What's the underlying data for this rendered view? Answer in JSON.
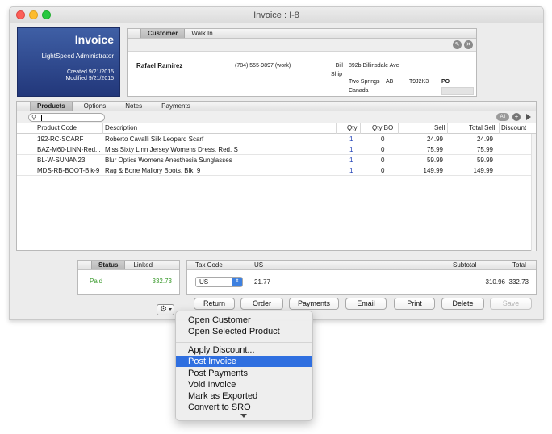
{
  "window": {
    "title": "Invoice : I-8"
  },
  "badge": {
    "title": "Invoice",
    "user": "LightSpeed Administrator",
    "created": "Created 9/21/2015",
    "modified": "Modified 9/21/2015"
  },
  "customer": {
    "tabs": [
      "Customer",
      "Walk In"
    ],
    "name": "Rafael Ramirez",
    "phone": "(784) 555-9897 (work)",
    "bill_label": "Bill",
    "ship_label": "Ship",
    "address": "892b Billinsdale Ave",
    "city": "Two Springs",
    "state": "AB",
    "zip": "T9J2K3",
    "country": "Canada",
    "po_label": "PO",
    "icons": [
      "edit-icon",
      "close-icon"
    ]
  },
  "products": {
    "tabs": [
      "Products",
      "Options",
      "Notes",
      "Payments"
    ],
    "search_placeholder": "",
    "all_label": "All",
    "columns": {
      "code": "Product Code",
      "description": "Description",
      "qty": "Qty",
      "qtybo": "Qty BO",
      "sell": "Sell",
      "total_sell": "Total Sell",
      "discount": "Discount"
    },
    "rows": [
      {
        "code": "192-RC-SCARF",
        "description": "Roberto Cavalli Silk Leopard Scarf",
        "qty": "1",
        "qtybo": "0",
        "sell": "24.99",
        "total": "24.99"
      },
      {
        "code": "BAZ-M60-LINN-Red...",
        "description": "Miss Sixty Linn Jersey Womens Dress, Red, S",
        "qty": "1",
        "qtybo": "0",
        "sell": "75.99",
        "total": "75.99"
      },
      {
        "code": "BL-W-SUNAN23",
        "description": "Blur Optics Womens Anesthesia Sunglasses",
        "qty": "1",
        "qtybo": "0",
        "sell": "59.99",
        "total": "59.99"
      },
      {
        "code": "MDS-RB-BOOT-Blk-9",
        "description": "Rag & Bone Mallory Boots, Blk, 9",
        "qty": "1",
        "qtybo": "0",
        "sell": "149.99",
        "total": "149.99"
      }
    ]
  },
  "status": {
    "tabs": [
      "Status",
      "Linked"
    ],
    "paid_label": "Paid",
    "paid_amount": "332.73"
  },
  "tax": {
    "headers": {
      "code": "Tax Code",
      "us": "US",
      "subtotal": "Subtotal",
      "total": "Total"
    },
    "selected": "US",
    "tax_value": "21.77",
    "subtotal": "310.96",
    "total": "332.73"
  },
  "buttons": {
    "return": "Return",
    "order": "Order",
    "payments": "Payments",
    "email": "Email",
    "print": "Print",
    "delete": "Delete",
    "save": "Save"
  },
  "menu": {
    "items": [
      "Open Customer",
      "Open Selected Product",
      "Apply Discount...",
      "Post Invoice",
      "Post Payments",
      "Void Invoice",
      "Mark as Exported",
      "Convert to SRO"
    ],
    "selected": "Post Invoice"
  },
  "colors": {
    "badge_blue": "#2c4588",
    "paid_green": "#3a9a2c",
    "menu_highlight": "#2f6fe0",
    "qty_blue": "#1e3fb5"
  }
}
